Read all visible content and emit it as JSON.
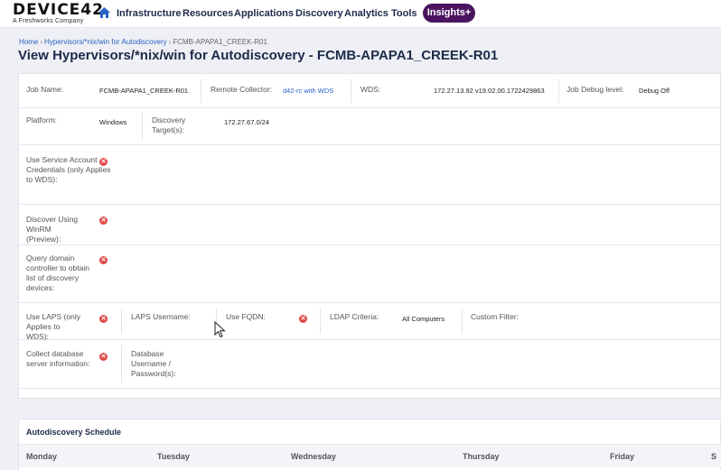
{
  "nav": {
    "logo_main": "DEVICE42",
    "logo_sub": "A Freshworks Company",
    "home_icon": "home-icon",
    "items": [
      "Infrastructure",
      "Resources",
      "Applications",
      "Discovery",
      "Analytics",
      "Tools"
    ],
    "insights_label": "Insights+",
    "insights_color": "#4a1460"
  },
  "breadcrumb": {
    "home": "Home",
    "section": "Hypervisors/*nix/win for Autodiscovery",
    "current": "FCMB-APAPA1_CREEK-R01"
  },
  "title": "View Hypervisors/*nix/win for Autodiscovery - FCMB-APAPA1_CREEK-R01",
  "details": {
    "job_name": {
      "label": "Job Name:",
      "value": "FCMB-APAPA1_CREEK-R01"
    },
    "remote_collector": {
      "label": "Remote Collector:",
      "value": "d42-rc with WDS"
    },
    "wds": {
      "label": "WDS:",
      "value": "172.27.13.92 v19.02.00.1722429863"
    },
    "job_debug_level": {
      "label": "Job Debug level:",
      "value": "Debug Off"
    },
    "platform": {
      "label": "Platform:",
      "value": "Windows"
    },
    "discovery_targets": {
      "label": "Discovery Target(s):",
      "value": "172.27.67.0/24"
    },
    "use_service_account": {
      "label": "Use Service Account Credentials (only Applies to WDS):",
      "value": "false"
    },
    "discover_winrm": {
      "label": "Discover Using WinRM (Preview):",
      "value": "false"
    },
    "query_domain_controller": {
      "label": "Query domain controller to obtain list of discovery devices:",
      "value": "false"
    },
    "use_laps": {
      "label": "Use LAPS (only Applies to WDS):",
      "value": "false"
    },
    "laps_username": {
      "label": "LAPS Username:",
      "value": ""
    },
    "use_fqdn": {
      "label": "Use FQDN:",
      "value": "false"
    },
    "ldap_criteria": {
      "label": "LDAP Criteria:",
      "value": "All Computers"
    },
    "custom_filter": {
      "label": "Custom Filter:",
      "value": ""
    },
    "collect_database": {
      "label": "Collect database server information:",
      "value": "false"
    },
    "database_credentials": {
      "label": "Database Username / Password(s):",
      "value": ""
    }
  },
  "status_icons": {
    "false": "x-circle-icon",
    "false_color": "#e04848"
  },
  "schedule": {
    "title": "Autodiscovery Schedule",
    "days": [
      "Monday",
      "Tuesday",
      "Wednesday",
      "Thursday",
      "Friday",
      "S"
    ]
  }
}
